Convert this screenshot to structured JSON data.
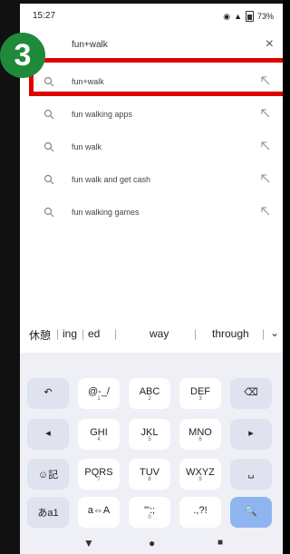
{
  "status": {
    "time": "15:27",
    "battery": "73%"
  },
  "search": {
    "query": "fun+walk",
    "clear": "×"
  },
  "suggestions": [
    "fun+walk",
    "fun walking apps",
    "fun walk",
    "fun walk and get cash",
    "fun walking games"
  ],
  "badge": "3",
  "predictions": [
    "休憩",
    "ing",
    "ed",
    "way",
    "through"
  ],
  "keys": {
    "row1": [
      {
        "main": "↶"
      },
      {
        "main": "@-_/",
        "sub": "1"
      },
      {
        "main": "ABC",
        "sub": "2"
      },
      {
        "main": "DEF",
        "sub": "3"
      },
      {
        "main": "⌫"
      }
    ],
    "row2": [
      {
        "main": "◂"
      },
      {
        "main": "GHI",
        "sub": "4"
      },
      {
        "main": "JKL",
        "sub": "5"
      },
      {
        "main": "MNO",
        "sub": "6"
      },
      {
        "main": "▸"
      }
    ],
    "row3": [
      {
        "main": "☺記"
      },
      {
        "main": "PQRS",
        "sub": "7"
      },
      {
        "main": "TUV",
        "sub": "8"
      },
      {
        "main": "WXYZ",
        "sub": "9"
      },
      {
        "main": "␣"
      }
    ],
    "row4": [
      {
        "main": "あa1"
      },
      {
        "main": "a⇔A"
      },
      {
        "main": "'\":;",
        "sub": "0"
      },
      {
        "main": ".,?!"
      },
      {
        "main": "🔍"
      }
    ]
  },
  "nav": {
    "back": "▼",
    "home": "●",
    "recents": "■"
  },
  "colors": {
    "highlight": "#e00000",
    "badge": "#1f8a3a",
    "action": "#8fb5f0"
  }
}
